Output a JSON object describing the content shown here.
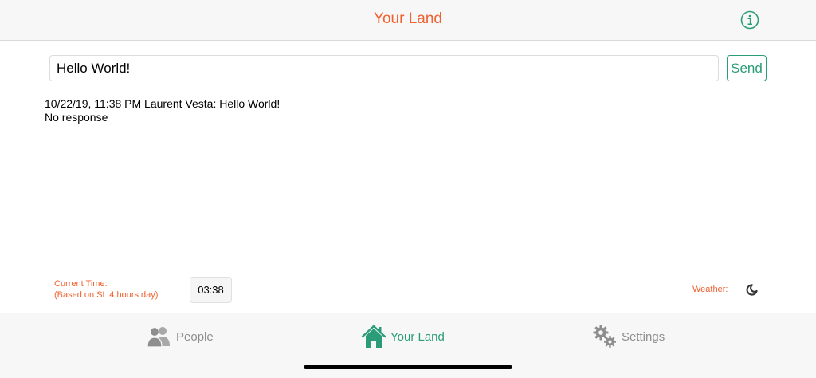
{
  "header": {
    "title": "Your Land",
    "info_icon": "info-circle-icon"
  },
  "composer": {
    "message_value": "Hello World!",
    "send_label": "Send"
  },
  "log": {
    "entries": [
      "10/22/19, 11:38 PM Laurent Vesta: Hello World!",
      "No response"
    ]
  },
  "status": {
    "time_label_line1": "Current Time:",
    "time_label_line2": "(Based on SL 4 hours day)",
    "time_value": "03:38",
    "weather_label": "Weather:",
    "weather_icon": "moon-icon"
  },
  "tabs": [
    {
      "label": "People",
      "icon": "people-icon",
      "active": false
    },
    {
      "label": "Your Land",
      "icon": "home-icon",
      "active": true
    },
    {
      "label": "Settings",
      "icon": "gears-icon",
      "active": false
    }
  ],
  "colors": {
    "accent_orange": "#f0612f",
    "accent_green": "#2a9d78",
    "inactive_gray": "#8e8e8e"
  }
}
